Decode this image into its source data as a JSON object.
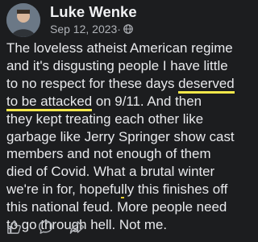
{
  "post": {
    "author": "Luke Wenke",
    "date": "Sep 12, 2023",
    "meta_separator": " · ",
    "body": {
      "l1": "The loveless atheist American regime",
      "l2": "and it's disgusting people I have little",
      "l3": "to no respect for these days ",
      "l3_highlight": "deserved",
      "l4_highlight": "to be attacked",
      "l4": " on 9/11.  And then",
      "l5": "they kept treating each other like",
      "l6": "garbage like Jerry Springer show cast",
      "l7": "members and not enough of them",
      "l8": "died of Covid.  What a brutal winter",
      "l9a": "we're in for, hopefu",
      "l9_mark": "l",
      "l9b": "ly this finishes off",
      "l10": "this national feud.  More people need",
      "l11": "to go through hell.  Not me."
    },
    "highlight_color": "#f3e74a",
    "icons": [
      "globe-icon",
      "more-icon",
      "like-icon",
      "comment-icon",
      "share-icon"
    ]
  }
}
